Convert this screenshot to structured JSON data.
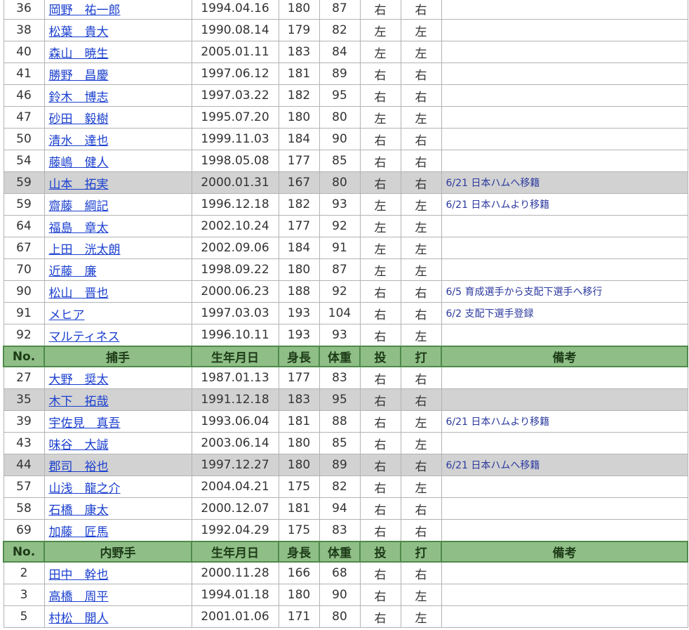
{
  "header": {
    "no": "No.",
    "birth": "生年月日",
    "height": "身長",
    "weight": "体重",
    "throws": "投",
    "bats": "打",
    "notes": "備考"
  },
  "sections": [
    {
      "title": "",
      "players": [
        {
          "no": "36",
          "name": "岡野　祐一郎",
          "birth": "1994.04.16",
          "height": "180",
          "weight": "87",
          "throws": "右",
          "bats": "右",
          "note": "",
          "moved": false
        },
        {
          "no": "38",
          "name": "松葉　貴大",
          "birth": "1990.08.14",
          "height": "179",
          "weight": "82",
          "throws": "左",
          "bats": "左",
          "note": "",
          "moved": false
        },
        {
          "no": "40",
          "name": "森山　暁生",
          "birth": "2005.01.11",
          "height": "183",
          "weight": "84",
          "throws": "左",
          "bats": "左",
          "note": "",
          "moved": false
        },
        {
          "no": "41",
          "name": "勝野　昌慶",
          "birth": "1997.06.12",
          "height": "181",
          "weight": "89",
          "throws": "右",
          "bats": "右",
          "note": "",
          "moved": false
        },
        {
          "no": "46",
          "name": "鈴木　博志",
          "birth": "1997.03.22",
          "height": "182",
          "weight": "95",
          "throws": "右",
          "bats": "右",
          "note": "",
          "moved": false
        },
        {
          "no": "47",
          "name": "砂田　毅樹",
          "birth": "1995.07.20",
          "height": "180",
          "weight": "80",
          "throws": "左",
          "bats": "左",
          "note": "",
          "moved": false
        },
        {
          "no": "50",
          "name": "清水　達也",
          "birth": "1999.11.03",
          "height": "184",
          "weight": "90",
          "throws": "右",
          "bats": "右",
          "note": "",
          "moved": false
        },
        {
          "no": "54",
          "name": "藤嶋　健人",
          "birth": "1998.05.08",
          "height": "177",
          "weight": "85",
          "throws": "右",
          "bats": "右",
          "note": "",
          "moved": false
        },
        {
          "no": "59",
          "name": "山本　拓実",
          "birth": "2000.01.31",
          "height": "167",
          "weight": "80",
          "throws": "右",
          "bats": "右",
          "note": "6/21 日本ハムへ移籍",
          "moved": true
        },
        {
          "no": "59",
          "name": "齋藤　綱記",
          "birth": "1996.12.18",
          "height": "182",
          "weight": "93",
          "throws": "左",
          "bats": "左",
          "note": "6/21 日本ハムより移籍",
          "moved": false
        },
        {
          "no": "64",
          "name": "福島　章太",
          "birth": "2002.10.24",
          "height": "177",
          "weight": "92",
          "throws": "左",
          "bats": "左",
          "note": "",
          "moved": false
        },
        {
          "no": "67",
          "name": "上田　洸太朗",
          "birth": "2002.09.06",
          "height": "184",
          "weight": "91",
          "throws": "左",
          "bats": "左",
          "note": "",
          "moved": false
        },
        {
          "no": "70",
          "name": "近藤　廉",
          "birth": "1998.09.22",
          "height": "180",
          "weight": "87",
          "throws": "左",
          "bats": "左",
          "note": "",
          "moved": false
        },
        {
          "no": "90",
          "name": "松山　晋也",
          "birth": "2000.06.23",
          "height": "188",
          "weight": "92",
          "throws": "右",
          "bats": "右",
          "note": "6/5 育成選手から支配下選手へ移行",
          "moved": false
        },
        {
          "no": "91",
          "name": "メヒア",
          "birth": "1997.03.03",
          "height": "193",
          "weight": "104",
          "throws": "右",
          "bats": "右",
          "note": "6/2 支配下選手登録",
          "moved": false
        },
        {
          "no": "92",
          "name": "マルティネス",
          "birth": "1996.10.11",
          "height": "193",
          "weight": "93",
          "throws": "右",
          "bats": "左",
          "note": "",
          "moved": false
        }
      ]
    },
    {
      "title": "捕手",
      "players": [
        {
          "no": "27",
          "name": "大野　奨太",
          "birth": "1987.01.13",
          "height": "177",
          "weight": "83",
          "throws": "右",
          "bats": "右",
          "note": "",
          "moved": false
        },
        {
          "no": "35",
          "name": "木下　拓哉",
          "birth": "1991.12.18",
          "height": "183",
          "weight": "95",
          "throws": "右",
          "bats": "右",
          "note": "",
          "moved": true
        },
        {
          "no": "39",
          "name": "宇佐見　真吾",
          "birth": "1993.06.04",
          "height": "181",
          "weight": "88",
          "throws": "右",
          "bats": "左",
          "note": "6/21 日本ハムより移籍",
          "moved": false
        },
        {
          "no": "43",
          "name": "味谷　大誠",
          "birth": "2003.06.14",
          "height": "180",
          "weight": "85",
          "throws": "右",
          "bats": "左",
          "note": "",
          "moved": false
        },
        {
          "no": "44",
          "name": "郡司　裕也",
          "birth": "1997.12.27",
          "height": "180",
          "weight": "89",
          "throws": "右",
          "bats": "右",
          "note": "6/21 日本ハムへ移籍",
          "moved": true
        },
        {
          "no": "57",
          "name": "山浅　龍之介",
          "birth": "2004.04.21",
          "height": "175",
          "weight": "82",
          "throws": "右",
          "bats": "左",
          "note": "",
          "moved": false
        },
        {
          "no": "58",
          "name": "石橋　康太",
          "birth": "2000.12.07",
          "height": "181",
          "weight": "94",
          "throws": "右",
          "bats": "右",
          "note": "",
          "moved": false
        },
        {
          "no": "69",
          "name": "加藤　匠馬",
          "birth": "1992.04.29",
          "height": "175",
          "weight": "83",
          "throws": "右",
          "bats": "右",
          "note": "",
          "moved": false
        }
      ]
    },
    {
      "title": "内野手",
      "players": [
        {
          "no": "2",
          "name": "田中　幹也",
          "birth": "2000.11.28",
          "height": "166",
          "weight": "68",
          "throws": "右",
          "bats": "右",
          "note": "",
          "moved": false
        },
        {
          "no": "3",
          "name": "高橋　周平",
          "birth": "1994.01.18",
          "height": "180",
          "weight": "90",
          "throws": "右",
          "bats": "左",
          "note": "",
          "moved": false
        },
        {
          "no": "5",
          "name": "村松　開人",
          "birth": "2001.01.06",
          "height": "171",
          "weight": "80",
          "throws": "右",
          "bats": "左",
          "note": "",
          "moved": false
        }
      ]
    }
  ]
}
